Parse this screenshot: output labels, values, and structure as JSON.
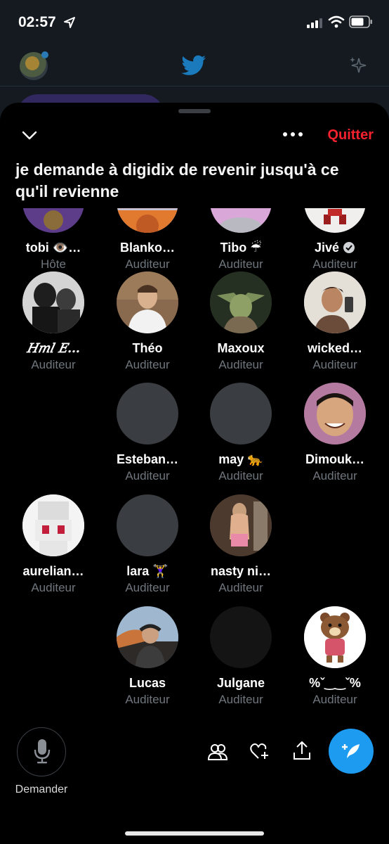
{
  "status": {
    "time": "02:57"
  },
  "colors": {
    "accent": "#1d9bf0",
    "quit": "#f4212e",
    "muted_text": "#6f767d"
  },
  "sheet": {
    "quit_label": "Quitter",
    "title": "je demande à digidix de revenir jusqu'à ce qu'il revienne"
  },
  "participants": [
    {
      "name": "tobi 👁️…",
      "role": "Hôte",
      "avatar": "cut-off"
    },
    {
      "name": "Blanko…",
      "role": "Auditeur",
      "avatar": "cut-off"
    },
    {
      "name": "Tibo ☔",
      "role": "Auditeur",
      "avatar": "cut-off"
    },
    {
      "name": "Jivé",
      "role": "Auditeur",
      "avatar": "cut-off",
      "verified": true
    },
    {
      "name": "𝐻𝑚𝑙 𝐸…",
      "role": "Auditeur",
      "avatar": "photo"
    },
    {
      "name": "Théo",
      "role": "Auditeur",
      "avatar": "photo"
    },
    {
      "name": "Maxoux",
      "role": "Auditeur",
      "avatar": "photo"
    },
    {
      "name": "wicked…",
      "role": "Auditeur",
      "avatar": "photo"
    },
    {
      "name": "Esteban…",
      "role": "Auditeur",
      "avatar": "blank"
    },
    {
      "name": "may 🐆",
      "role": "Auditeur",
      "avatar": "blank"
    },
    {
      "name": "Dimouk…",
      "role": "Auditeur",
      "avatar": "photo"
    },
    {
      "name": "aurelian…",
      "role": "Auditeur",
      "avatar": "pixel"
    },
    {
      "name": "lara 🏋️‍♀️",
      "role": "Auditeur",
      "avatar": "blank"
    },
    {
      "name": "nasty ni…",
      "role": "Auditeur",
      "avatar": "photo"
    },
    {
      "name": "Lucas",
      "role": "Auditeur",
      "avatar": "photo"
    },
    {
      "name": "Julgane",
      "role": "Auditeur",
      "avatar": "blank"
    },
    {
      "name": "%ˇ‿‿ˇ%",
      "role": "Auditeur",
      "avatar": "bear"
    }
  ],
  "bottom_bar": {
    "mic_label": "Demander"
  }
}
